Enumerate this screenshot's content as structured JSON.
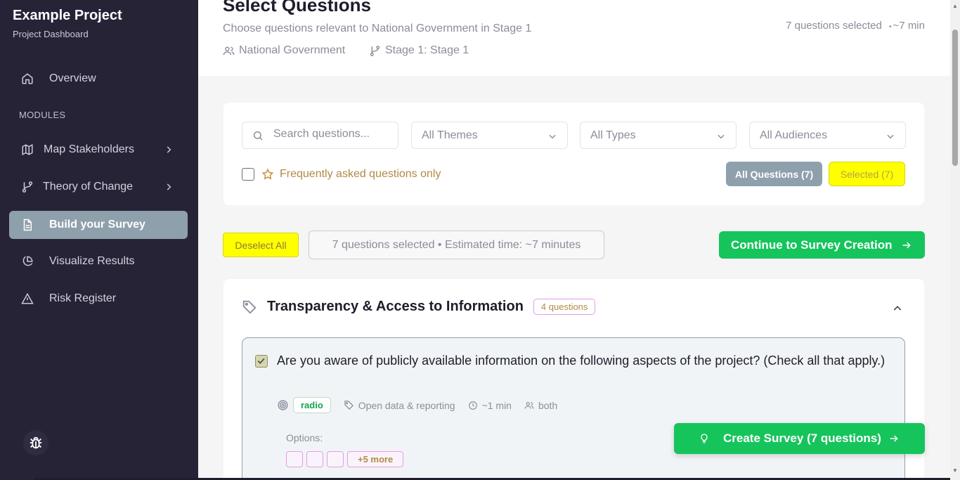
{
  "sidebar": {
    "project_title": "Example Project",
    "project_subtitle": "Project Dashboard",
    "modules_label": "MODULES",
    "items": [
      {
        "label": "Overview",
        "icon": "home-icon"
      },
      {
        "label": "Map Stakeholders",
        "icon": "map-icon"
      },
      {
        "label": "Theory of Change",
        "icon": "git-branch-icon"
      },
      {
        "label": "Build your Survey",
        "icon": "document-icon",
        "active": true
      },
      {
        "label": "Visualize Results",
        "icon": "pie-chart-icon"
      },
      {
        "label": "Risk Register",
        "icon": "warning-icon"
      }
    ]
  },
  "header": {
    "title": "Select Questions",
    "subtitle": "Choose questions relevant to National Government in Stage 1",
    "audience": "National Government",
    "stage": "Stage 1: Stage 1",
    "selected_count": "7 questions selected",
    "estimate": "~7 min"
  },
  "filters": {
    "search_placeholder": "Search questions...",
    "themes": "All Themes",
    "types": "All Types",
    "audiences": "All Audiences",
    "faq_label": "Frequently asked questions only",
    "all_questions_button": "All Questions (7)",
    "selected_button": "Selected (7)"
  },
  "actions": {
    "deselect_all": "Deselect All",
    "selection_info": "7 questions selected • Estimated time: ~7 minutes",
    "continue_button": "Continue to Survey Creation"
  },
  "theme": {
    "title": "Transparency & Access to Information",
    "badge": "4 questions",
    "question": {
      "text": "Are you aware of publicly available information on the following aspects of the project? (Check all that apply.)",
      "type": "radio",
      "category": "Open data & reporting",
      "time": "~1 min",
      "audience": "both",
      "options_label": "Options:",
      "more_options": "+5 more"
    }
  },
  "floating": {
    "create_button": "Create Survey (7 questions)"
  },
  "colors": {
    "sidebar_bg": "#272337",
    "active_nav": "#8fa0ad",
    "primary_green": "#16c45c",
    "highlight_yellow": "#ffff00",
    "accent_gold": "#b08b46",
    "badge_pink": "#e59be8"
  }
}
